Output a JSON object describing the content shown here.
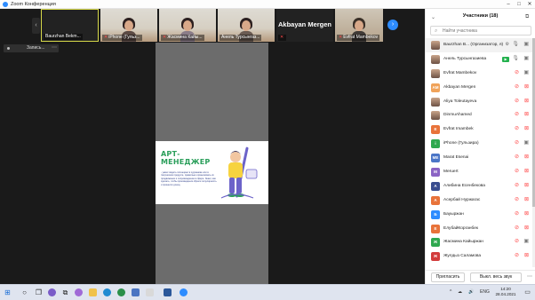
{
  "window": {
    "title": "Zoom Конференция",
    "controls": [
      "–",
      "□",
      "✕"
    ]
  },
  "video_strip": {
    "prev_icon": "chevron-left-icon",
    "next_icon": "chevron-right-icon",
    "tiles": [
      {
        "name": "Baurzhan Bekm...",
        "muted": false,
        "video": false,
        "active": true
      },
      {
        "name": "iPhone (Гульз...",
        "muted": true,
        "video": true
      },
      {
        "name": "Жасмина Кайы...",
        "muted": true,
        "video": true
      },
      {
        "name": "Анель Турсынгаз...",
        "muted": false,
        "video": true
      },
      {
        "name": "Akbayan Mergen",
        "muted": true,
        "video": false,
        "big": true
      },
      {
        "name": "Evfrat Mambekov",
        "muted": true,
        "video": true
      }
    ]
  },
  "recording": {
    "label": "Запись...",
    "more": "⋯"
  },
  "shared_slide": {
    "title_line1": "АРТ-",
    "title_line2": "МЕНЕДЖЕР",
    "description": "- умеет видеть потенциал в художнике или в творческом продукте, правильно организовать их продвижение и сопровождение в сфере. Знает, как сделать, чтобы произведения обрели популярность и принесли доход."
  },
  "participants_panel": {
    "title": "Участники (18)",
    "search_placeholder": "Найти участника",
    "participants": [
      {
        "name": "Baurzhan B... (Организатор, я)",
        "initials": "",
        "avatar_color": "",
        "photo": true,
        "mic": "on",
        "video": "on",
        "host": true
      },
      {
        "name": "Анель Турсынгазиева",
        "initials": "",
        "avatar_color": "",
        "photo": true,
        "mic": "on",
        "video": "on",
        "sharing": true
      },
      {
        "name": "Evfrat Mambekov",
        "initials": "",
        "avatar_color": "",
        "photo": true,
        "mic": "off",
        "video": "on"
      },
      {
        "name": "Akbayan Mergen",
        "initials": "AM",
        "avatar_color": "#f0a35a",
        "mic": "off",
        "video": "off"
      },
      {
        "name": "Aliya Toleutayeva",
        "initials": "",
        "avatar_color": "",
        "photo": true,
        "mic": "off",
        "video": "off"
      },
      {
        "name": "DinmuAhamed",
        "initials": "",
        "avatar_color": "",
        "photo": true,
        "mic": "off",
        "video": "off"
      },
      {
        "name": "Evfrat Imambek",
        "initials": "E",
        "avatar_color": "#e8733a",
        "mic": "off",
        "video": "off"
      },
      {
        "name": "iPhone (Гульзира)",
        "initials": "i",
        "avatar_color": "#2fa84f",
        "mic": "off",
        "video": "on"
      },
      {
        "name": "Marat Esenai",
        "initials": "ME",
        "avatar_color": "#4b76c7",
        "mic": "off",
        "video": "off"
      },
      {
        "name": "Meruert",
        "initials": "M",
        "avatar_color": "#8a63c4",
        "mic": "off",
        "video": "off"
      },
      {
        "name": "Алибина Есенбекова",
        "initials": "А",
        "avatar_color": "#3a4d8f",
        "mic": "off",
        "video": "off"
      },
      {
        "name": "Асербай Нуржагас",
        "initials": "А",
        "avatar_color": "#e8733a",
        "mic": "off",
        "video": "off"
      },
      {
        "name": "Бауыржан",
        "initials": "Б",
        "avatar_color": "#2d8cff",
        "mic": "off",
        "video": "off"
      },
      {
        "name": "ЕлубайКорганбек",
        "initials": "Е",
        "avatar_color": "#e8733a",
        "mic": "off",
        "video": "off"
      },
      {
        "name": "Жасмина Кайыржан",
        "initials": "Ж",
        "avatar_color": "#2fa84f",
        "mic": "off",
        "video": "on"
      },
      {
        "name": "Жулдыз Саламова",
        "initials": "Ж",
        "avatar_color": "#d23b3b",
        "mic": "off",
        "video": "off"
      }
    ],
    "invite_label": "Пригласить",
    "mute_all_label": "Выкл. весь звук",
    "more": "⋯"
  },
  "taskbar": {
    "icons": [
      "windows-start-icon",
      "search-icon",
      "task-view-icon",
      "widgets-icon",
      "chat-icon",
      "explorer-icon",
      "edge-icon",
      "chrome-icon",
      "store-icon",
      "word-icon",
      "zoom-icon"
    ],
    "tray": [
      "^",
      "☁",
      "🔊",
      "ENG"
    ],
    "time": "14:20",
    "date": "28.04.2021"
  }
}
